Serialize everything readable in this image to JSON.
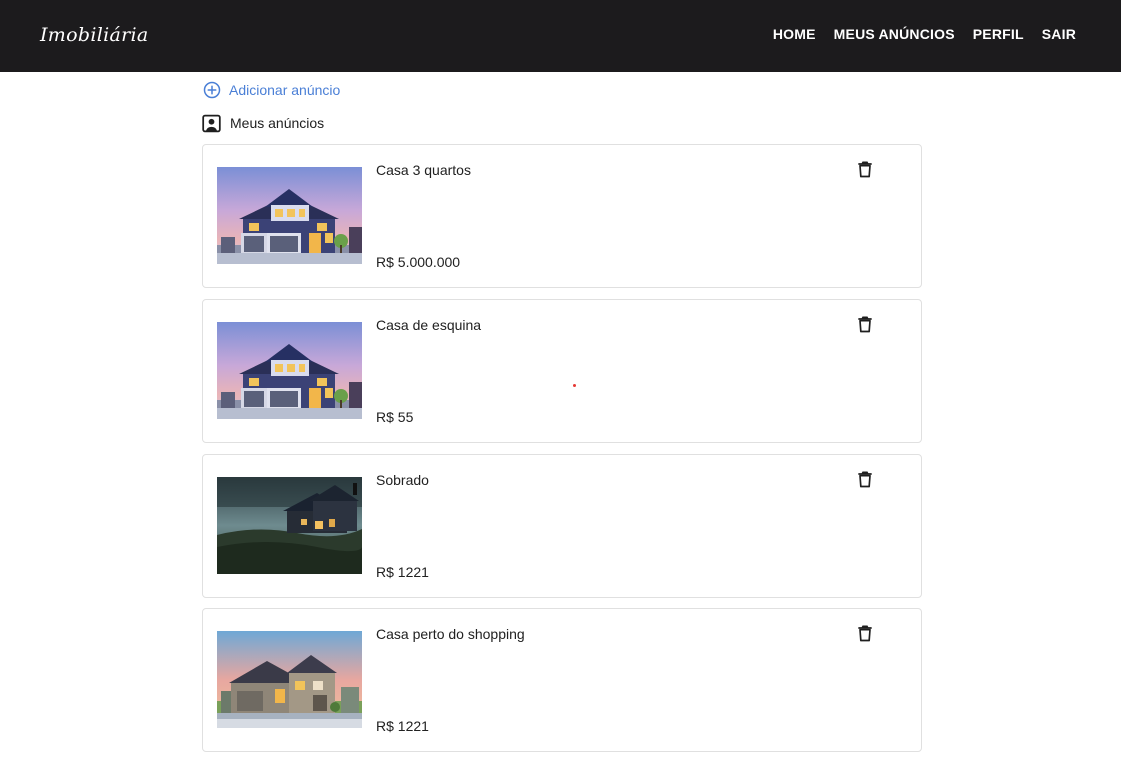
{
  "header": {
    "brand": "Imobiliária",
    "nav": [
      "HOME",
      "MEUS ANÚNCIOS",
      "PERFIL",
      "SAIR"
    ]
  },
  "actions": {
    "add_label": "Adicionar anúncio",
    "mine_label": "Meus anúncios"
  },
  "listings": [
    {
      "title": "Casa 3 quartos",
      "price": "R$ 5.000.000",
      "image": "two-story-house-dusk"
    },
    {
      "title": "Casa de esquina",
      "price": "R$ 55",
      "image": "two-story-house-dusk"
    },
    {
      "title": "Sobrado",
      "price": "R$ 1221",
      "image": "hillside-house-night"
    },
    {
      "title": "Casa perto do shopping",
      "price": "R$ 1221",
      "image": "suburban-house-sunset"
    }
  ],
  "colors": {
    "topbar": "#1c1b1d",
    "link_blue": "#4a7fd6",
    "card_border": "#e0e0e0"
  },
  "icons": {
    "add": "plus-circle-icon",
    "mine": "account-box-icon",
    "delete": "trash-icon"
  }
}
